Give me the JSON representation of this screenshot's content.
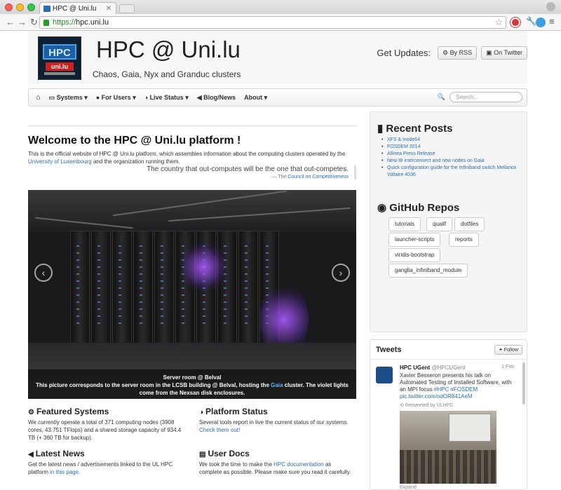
{
  "browser": {
    "tab_title": "HPC @ Uni.lu",
    "address": "hpc.uni.lu",
    "address_scheme": "https://"
  },
  "header": {
    "logo_text": "HPC",
    "logo_sub": "uni.lu",
    "title": "HPC @ Uni.lu",
    "subtitle": "Chaos, Gaia, Nyx and Granduc clusters",
    "updates_label": "Get Updates:",
    "rss_label": "By RSS",
    "twitter_label": "On Twitter"
  },
  "nav": {
    "items": [
      {
        "label": "Systems",
        "icon": "monitor-icon"
      },
      {
        "label": "For Users",
        "icon": "user-icon"
      },
      {
        "label": "Live Status",
        "icon": "dashboard-icon"
      },
      {
        "label": "Blog/News",
        "icon": "bullhorn-icon"
      },
      {
        "label": "About",
        "icon": ""
      }
    ],
    "search_placeholder": "Search..."
  },
  "main": {
    "welcome": "Welcome to the HPC @ Uni.lu platform !",
    "intro_1": "This is the official website of HPC @ Uni.lu platform, which assembles information about the computing clusters operated by the",
    "intro_link": "University of Luxembourg",
    "intro_2": "and the organization running them.",
    "quote": "The country that out-computes will be the one that out-competes.",
    "quote_dash": "— The",
    "quote_source": "Council on Competitiveness",
    "carousel": {
      "caption_title": "Server room @ Belval",
      "caption_pre": "This picture corresponds to the server room in the LCSB building @ Belval, hosting the",
      "caption_link": "Gaia",
      "caption_post": "cluster. The violet lights come from the Nexsan disk enclosures."
    },
    "featured": {
      "title": "Featured Systems",
      "text": "We currently operate a total of 371 computing nodes (3908 cores, 43.751 TFlops) and a shared storage capacity of 934.4 TB (+ 360 TB for backup)."
    },
    "platform": {
      "title": "Platform Status",
      "text": "Several tools report in live the current status of our systems.",
      "link": "Check them out!"
    },
    "news": {
      "title": "Latest News",
      "text": "Get the latest news / advertisements linked to the UL HPC platform",
      "link": "in this page",
      "tail": "."
    },
    "docs": {
      "title": "User Docs",
      "pre": "We took the time to make the",
      "link": "HPC documentation",
      "post": "as complete as possible. Please make sure you read it carefully."
    }
  },
  "sidebar": {
    "recent_title": "Recent Posts",
    "posts": [
      "XFS & inode64",
      "FOSDEM 2014",
      "Allinea Press Release",
      "New IB interconnect and new nodes on Gaia",
      "Quick configuration guide for the Infiniband switch Mellanox Voltaire 4036"
    ],
    "github_title": "GitHub Repos",
    "repos": [
      "tutorials",
      "qualif",
      "dotfiles",
      "launcher-scripts",
      "reports",
      "viridis-bootstrap",
      "ganglia_infiniband_module"
    ],
    "tweets": {
      "title": "Tweets",
      "follow": "Follow",
      "author": "HPC UGent",
      "handle": "@HPCUGent",
      "date": "1 Feb",
      "text": "Xavier Besseron presents his talk on Automated Testing of Installed Software, with an MPI focus",
      "tags": "#HPC #FOSDEM",
      "pic": "pic.twitter.com/odOR841AeM",
      "retweet": "Retweeted by ULHPC",
      "expand": "Expand"
    }
  }
}
